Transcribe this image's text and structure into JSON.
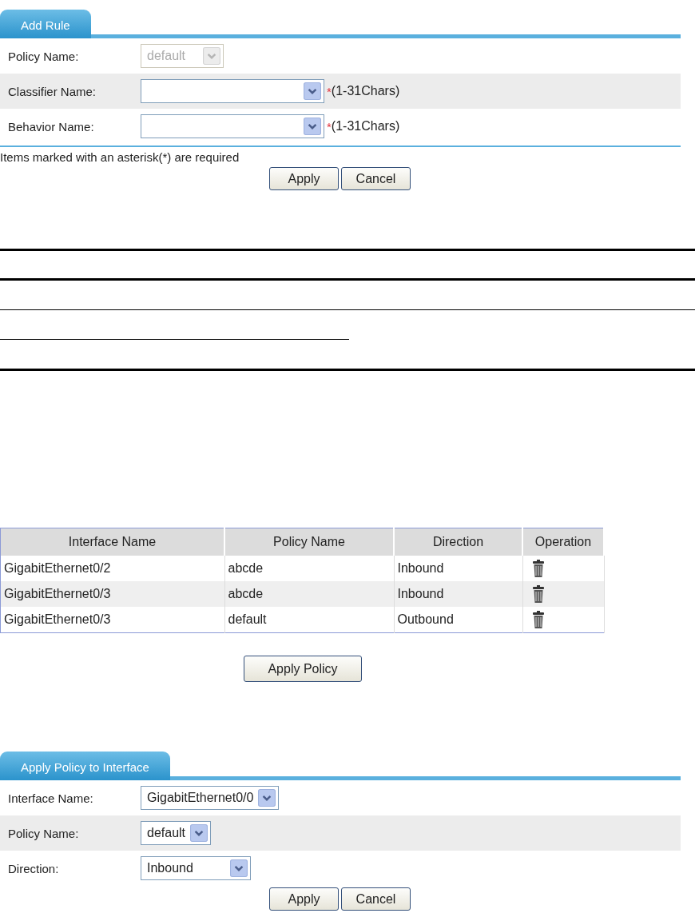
{
  "add_rule_form": {
    "tab": {
      "label": "Add Rule",
      "selected": true
    },
    "fields": [
      {
        "label": "Policy Name:",
        "value": "default",
        "disabled": true
      },
      {
        "label": "Classifier Name:",
        "disabled": false,
        "required_mark": "*",
        "hint": "(1-31Chars)"
      },
      {
        "label": "Behavior Name:",
        "disabled": false,
        "required_mark": "*",
        "hint": "(1-31Chars)"
      }
    ],
    "note": "Items marked with an asterisk(*) are required",
    "buttons": [
      "Apply",
      "Cancel"
    ]
  },
  "policy_table": {
    "columns": [
      "Interface Name",
      "Policy Name",
      "Direction",
      "Operation"
    ],
    "rows": [
      {
        "interface": "GigabitEthernet0/2",
        "policy": "abcde",
        "direction": "Inbound"
      },
      {
        "interface": "GigabitEthernet0/3",
        "policy": "abcde",
        "direction": "Inbound"
      },
      {
        "interface": "GigabitEthernet0/3",
        "policy": "default",
        "direction": "Outbound"
      }
    ],
    "button": "Apply Policy"
  },
  "apply_policy_form": {
    "tab": {
      "label": "Apply Policy to Interface",
      "selected": true
    },
    "fields": [
      {
        "label": "Interface Name:",
        "value": "GigabitEthernet0/0",
        "disabled": false
      },
      {
        "label": "Policy Name:",
        "value": "default",
        "disabled": false
      },
      {
        "label": "Direction:",
        "value": "Inbound",
        "disabled": false
      }
    ],
    "buttons": [
      "Apply",
      "Cancel"
    ]
  }
}
